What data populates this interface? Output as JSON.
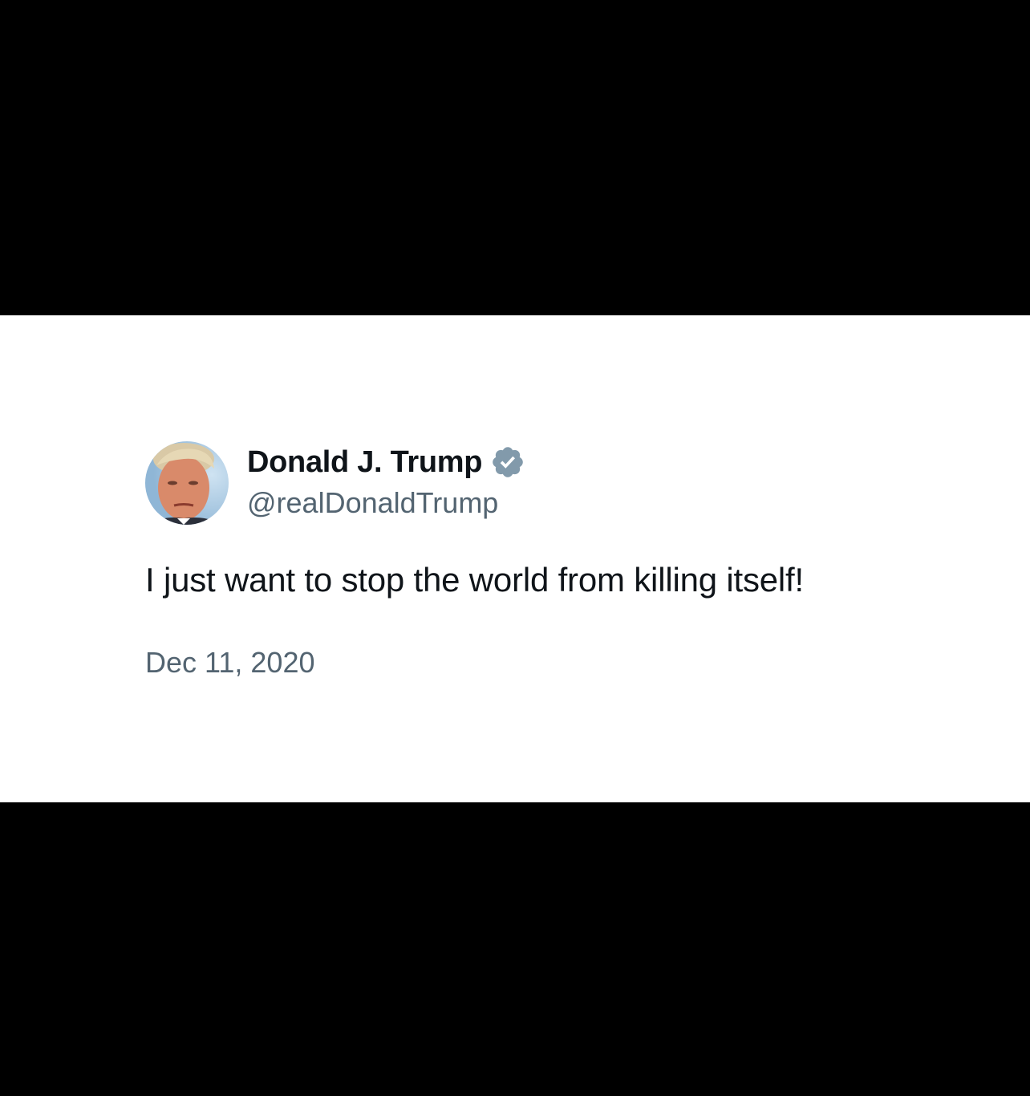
{
  "tweet": {
    "display_name": "Donald J. Trump",
    "handle": "@realDonaldTrump",
    "text": "I just want to stop the world from killing itself!",
    "date": "Dec 11, 2020",
    "verified": true
  },
  "icons": {
    "avatar": "profile-photo",
    "badge": "verified-badge-icon"
  },
  "colors": {
    "background": "#000000",
    "card": "#ffffff",
    "primary_text": "#0f1419",
    "secondary_text": "#536471",
    "badge": "#829aab"
  }
}
